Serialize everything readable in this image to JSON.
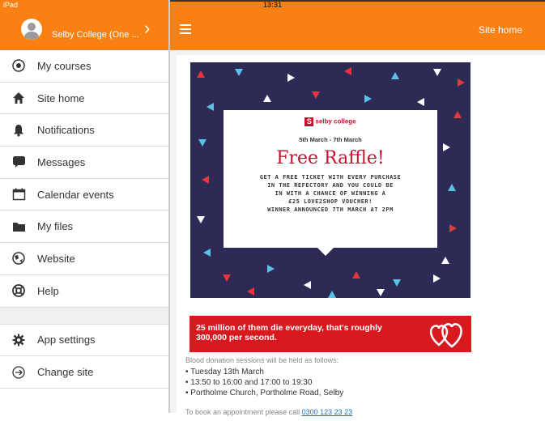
{
  "status": {
    "device": "iPad",
    "time": "13:31"
  },
  "sidebar": {
    "site_name": "Selby College (One ...",
    "items": [
      {
        "label": "My courses",
        "icon": "my-courses-icon"
      },
      {
        "label": "Site home",
        "icon": "home-icon"
      },
      {
        "label": "Notifications",
        "icon": "bell-icon"
      },
      {
        "label": "Messages",
        "icon": "message-icon"
      },
      {
        "label": "Calendar events",
        "icon": "calendar-icon"
      },
      {
        "label": "My files",
        "icon": "folder-icon"
      },
      {
        "label": "Website",
        "icon": "globe-icon"
      },
      {
        "label": "Help",
        "icon": "help-icon"
      }
    ],
    "bottom_items": [
      {
        "label": "App settings",
        "icon": "gear-icon"
      },
      {
        "label": "Change site",
        "icon": "change-site-icon"
      }
    ]
  },
  "header": {
    "title": "Site home"
  },
  "poster": {
    "logo_text": "selby college",
    "dates": "5th March - 7th March",
    "headline": "Free Raffle!",
    "lines": [
      "GET A FREE TICKET WITH EVERY PURCHASE",
      "IN THE REFECTORY AND YOU COULD BE",
      "IN WITH A CHANCE OF WINNING A",
      "£25 LOVE2SHOP VOUCHER!",
      "WINNER ANNOUNCED 7TH MARCH AT 2PM"
    ]
  },
  "blood": {
    "banner_line1": "25 million of them die everyday, that's roughly",
    "banner_line2": "300,000 per second.",
    "intro": "Blood donation sessions will be held as follows:",
    "bullets": [
      "Tuesday 13th March",
      "13:50 to 16:00 and 17:00 to 19:30",
      "Portholme Church, Portholme Road, Selby"
    ],
    "book_text": "To book an appointment please call ",
    "phone": "0300 123 23 23"
  },
  "colors": {
    "accent": "#f98012",
    "poster_bg": "#2d2a55",
    "red": "#c8102e"
  }
}
